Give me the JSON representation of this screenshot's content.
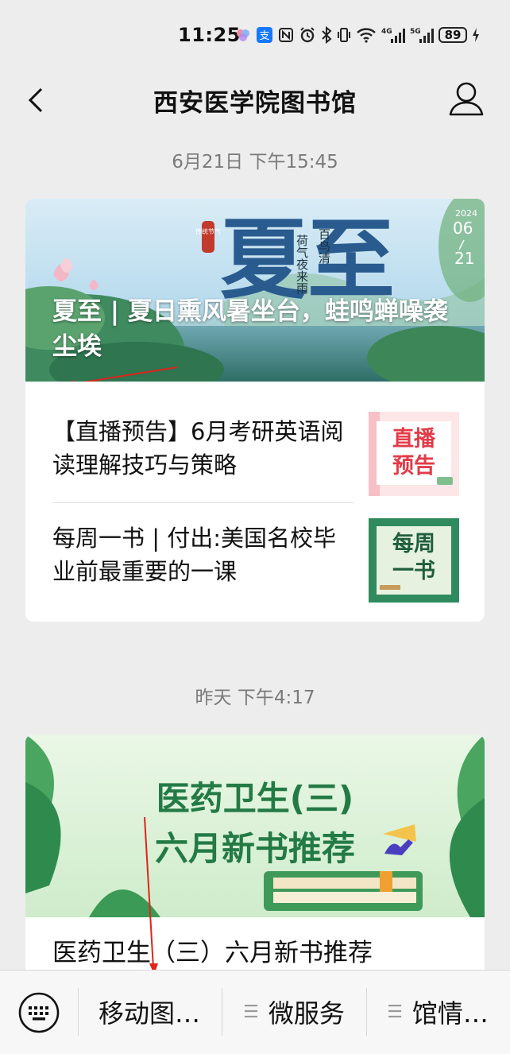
{
  "status_bar": {
    "time": "11:25",
    "net1": "4G",
    "net2": "5G",
    "battery": "89"
  },
  "nav": {
    "title": "西安医学院图书馆"
  },
  "messages": [
    {
      "timestamp": "6月21日 下午15:45",
      "hero": {
        "title": "夏至 | 夏日熏风暑坐台，蛙鸣蝉噪袭尘埃",
        "art_big": "夏至",
        "art_seal": "传统节气",
        "art_poem1": "荷气夜来雨",
        "art_poem2": "百鸟清",
        "art_year": "2024",
        "art_month": "06",
        "art_day": "21"
      },
      "items": [
        {
          "title": "【直播预告】6月考研英语阅读理解技巧与策略",
          "thumb_text": "直播预告"
        },
        {
          "title": "每周一书 | 付出:美国名校毕业前最重要的一课",
          "thumb_text": "每周一书"
        }
      ]
    },
    {
      "timestamp": "昨天 下午4:17",
      "hero": {
        "art_line1": "医药卫生(三)",
        "art_line2": "六月新书推荐"
      },
      "first_item_title": "医药卫生（三）六月新书推荐"
    }
  ],
  "bottom_menu": {
    "items": [
      {
        "label": "移动图…"
      },
      {
        "label": "微服务"
      },
      {
        "label": "馆情…"
      }
    ]
  }
}
